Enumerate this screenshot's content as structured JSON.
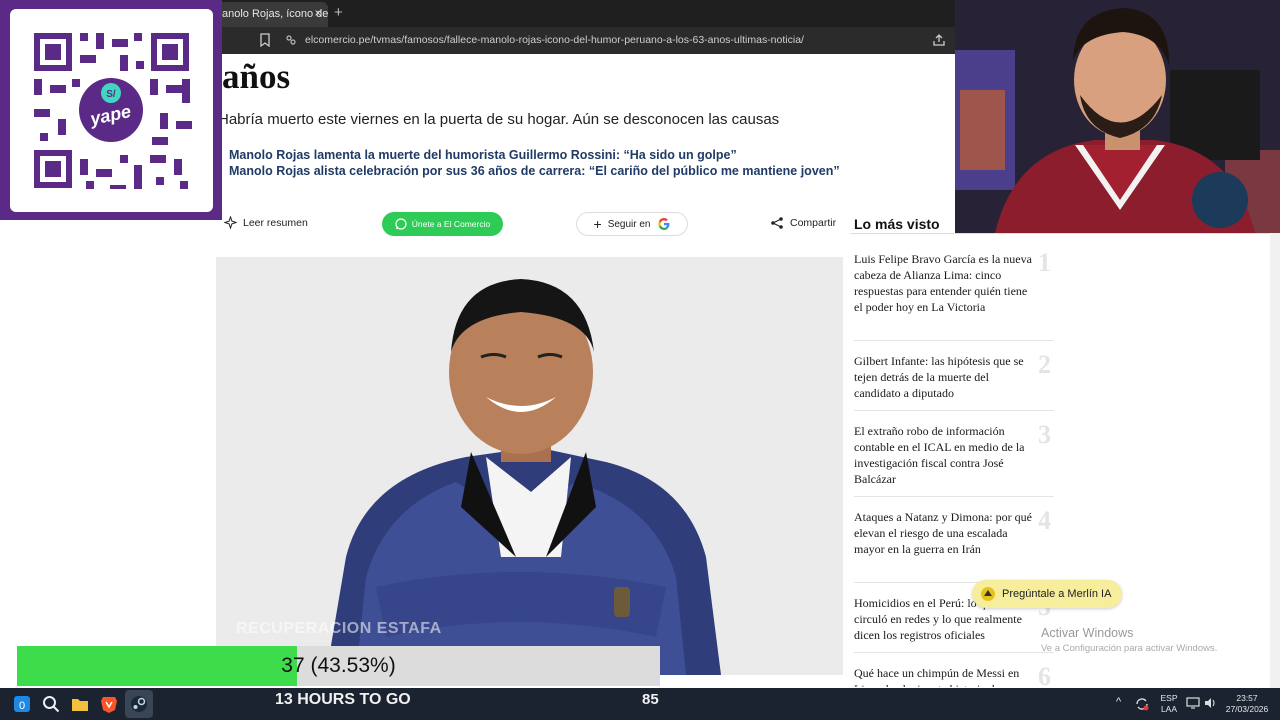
{
  "browser": {
    "tab_title": "anolo Rojas, ícono del h",
    "tab_close": "×",
    "new_tab": "+",
    "url": "elcomercio.pe/tvmas/famosos/fallece-manolo-rojas-icono-del-humor-peruano-a-los-63-anos-ultimas-noticia/"
  },
  "article": {
    "headline_fragment": "años",
    "subheadline": "Habría muerto este viernes en la puerta de su hogar. Aún se desconocen las causas",
    "related": [
      "Manolo Rojas lamenta la muerte del humorista Guillermo Rossini: “Ha sido un golpe”",
      "Manolo Rojas alista celebración por sus 36 años de carrera: “El cariño del público me mantiene joven”"
    ],
    "actions": {
      "summary": "Leer resumen",
      "whatsapp": "Únete a El Comercio",
      "follow": "Seguir en",
      "share": "Compartir"
    }
  },
  "sidebar": {
    "title": "Lo más visto",
    "items": [
      {
        "num": "1",
        "text": "Luis Felipe Bravo García es la nueva cabeza de Alianza Lima: cinco respuestas para entender quién tiene el poder hoy en La Victoria"
      },
      {
        "num": "2",
        "text": "Gilbert Infante: las hipótesis que se tejen detrás de la muerte del candidato a diputado"
      },
      {
        "num": "3",
        "text": "El extraño robo de información contable en el ICAL en medio de la investigación fiscal contra José Balcázar"
      },
      {
        "num": "4",
        "text": "Ataques a Natanz y Dimona: por qué elevan el riesgo de una escalada mayor en la guerra en Irán"
      },
      {
        "num": "5",
        "text": "Homicidios en el Perú: lo que circuló en redes y lo que realmente dicen los registros oficiales"
      },
      {
        "num": "6",
        "text": "Qué hace un chimpún de Messi en Lima: la alucinante historia de una"
      }
    ]
  },
  "overlay": {
    "qr_brand": "yape",
    "qr_symbol": "S/",
    "merlin": "Pregúntale a Merlín IA",
    "watermark": "RECUPERACION ESTAFA",
    "progress_label": "37 (43.53%)",
    "progress_fraction": 0.4353,
    "countdown": "13 HOURS TO GO",
    "count": "85",
    "activate_title": "Activar Windows",
    "activate_sub": "Ve a Configuración para activar Windows."
  },
  "taskbar": {
    "lang": "ESP",
    "layout": "LAA",
    "time": "23:57",
    "date": "27/03/2026",
    "tray_caret": "^"
  },
  "colors": {
    "accent_green": "#3cdc4b",
    "whatsapp": "#2ecc56",
    "yape_purple": "#5b2a86",
    "link_blue": "#1f3b66"
  }
}
